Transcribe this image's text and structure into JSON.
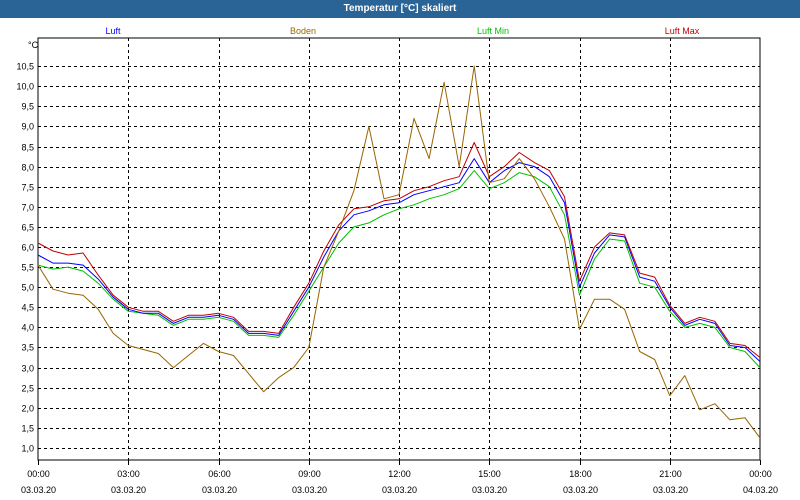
{
  "chart_data": {
    "type": "line",
    "title": "Temperatur [°C] skaliert",
    "ylabel": "°C",
    "ylim": [
      0.7,
      11.2
    ],
    "xlim_hours": [
      0,
      24
    ],
    "grid": true,
    "y_ticks": [
      "1,0",
      "1,5",
      "2,0",
      "2,5",
      "3,0",
      "3,5",
      "4,0",
      "4,5",
      "5,0",
      "5,5",
      "6,0",
      "6,5",
      "7,0",
      "7,5",
      "8,0",
      "8,5",
      "9,0",
      "9,5",
      "10,0",
      "10,5"
    ],
    "x_ticks": [
      {
        "time": "00:00",
        "date": "03.03.20"
      },
      {
        "time": "03:00",
        "date": "03.03.20"
      },
      {
        "time": "06:00",
        "date": "03.03.20"
      },
      {
        "time": "09:00",
        "date": "03.03.20"
      },
      {
        "time": "12:00",
        "date": "03.03.20"
      },
      {
        "time": "15:00",
        "date": "03.03.20"
      },
      {
        "time": "18:00",
        "date": "03.03.20"
      },
      {
        "time": "21:00",
        "date": "03.03.20"
      },
      {
        "time": "00:00",
        "date": "04.03.20"
      }
    ],
    "series": [
      {
        "name": "Luft Min",
        "color": "#00c000",
        "points": [
          [
            0,
            5.55
          ],
          [
            0.5,
            5.45
          ],
          [
            1,
            5.5
          ],
          [
            1.5,
            5.4
          ],
          [
            2,
            5.1
          ],
          [
            2.5,
            4.7
          ],
          [
            3,
            4.4
          ],
          [
            3.5,
            4.35
          ],
          [
            4,
            4.3
          ],
          [
            4.5,
            4.05
          ],
          [
            5,
            4.2
          ],
          [
            5.5,
            4.2
          ],
          [
            6,
            4.25
          ],
          [
            6.5,
            4.15
          ],
          [
            7,
            3.8
          ],
          [
            7.5,
            3.8
          ],
          [
            8,
            3.75
          ],
          [
            8.5,
            4.3
          ],
          [
            9,
            4.9
          ],
          [
            9.5,
            5.5
          ],
          [
            10,
            6.1
          ],
          [
            10.5,
            6.5
          ],
          [
            11,
            6.6
          ],
          [
            11.5,
            6.8
          ],
          [
            12,
            6.95
          ],
          [
            12.5,
            7.05
          ],
          [
            13,
            7.2
          ],
          [
            13.5,
            7.3
          ],
          [
            14,
            7.45
          ],
          [
            14.5,
            7.9
          ],
          [
            15,
            7.45
          ],
          [
            15.5,
            7.6
          ],
          [
            16,
            7.85
          ],
          [
            16.5,
            7.75
          ],
          [
            17,
            7.5
          ],
          [
            17.5,
            6.8
          ],
          [
            18,
            4.8
          ],
          [
            18.5,
            5.7
          ],
          [
            19,
            6.2
          ],
          [
            19.5,
            6.15
          ],
          [
            20,
            5.1
          ],
          [
            20.5,
            5.0
          ],
          [
            21,
            4.4
          ],
          [
            21.5,
            4.0
          ],
          [
            22,
            4.1
          ],
          [
            22.5,
            4.0
          ],
          [
            23,
            3.5
          ],
          [
            23.5,
            3.4
          ],
          [
            24,
            3.0
          ]
        ]
      },
      {
        "name": "Luft",
        "color": "#0000ff",
        "points": [
          [
            0,
            5.8
          ],
          [
            0.5,
            5.6
          ],
          [
            1,
            5.6
          ],
          [
            1.5,
            5.55
          ],
          [
            2,
            5.2
          ],
          [
            2.5,
            4.75
          ],
          [
            3,
            4.45
          ],
          [
            3.5,
            4.35
          ],
          [
            4,
            4.35
          ],
          [
            4.5,
            4.1
          ],
          [
            5,
            4.25
          ],
          [
            5.5,
            4.25
          ],
          [
            6,
            4.3
          ],
          [
            6.5,
            4.2
          ],
          [
            7,
            3.85
          ],
          [
            7.5,
            3.85
          ],
          [
            8,
            3.8
          ],
          [
            8.5,
            4.4
          ],
          [
            9,
            5.0
          ],
          [
            9.5,
            5.75
          ],
          [
            10,
            6.4
          ],
          [
            10.5,
            6.8
          ],
          [
            11,
            6.9
          ],
          [
            11.5,
            7.05
          ],
          [
            12,
            7.1
          ],
          [
            12.5,
            7.3
          ],
          [
            13,
            7.4
          ],
          [
            13.5,
            7.5
          ],
          [
            14,
            7.6
          ],
          [
            14.5,
            8.2
          ],
          [
            15,
            7.6
          ],
          [
            15.5,
            7.9
          ],
          [
            16,
            8.1
          ],
          [
            16.5,
            8.0
          ],
          [
            17,
            7.75
          ],
          [
            17.5,
            7.1
          ],
          [
            18,
            5.0
          ],
          [
            18.5,
            5.85
          ],
          [
            19,
            6.3
          ],
          [
            19.5,
            6.25
          ],
          [
            20,
            5.25
          ],
          [
            20.5,
            5.15
          ],
          [
            21,
            4.5
          ],
          [
            21.5,
            4.05
          ],
          [
            22,
            4.2
          ],
          [
            22.5,
            4.1
          ],
          [
            23,
            3.55
          ],
          [
            23.5,
            3.5
          ],
          [
            24,
            3.15
          ]
        ]
      },
      {
        "name": "Luft Max",
        "color": "#c00000",
        "points": [
          [
            0,
            6.1
          ],
          [
            0.5,
            5.9
          ],
          [
            1,
            5.8
          ],
          [
            1.5,
            5.85
          ],
          [
            2,
            5.3
          ],
          [
            2.5,
            4.8
          ],
          [
            3,
            4.5
          ],
          [
            3.5,
            4.4
          ],
          [
            4,
            4.4
          ],
          [
            4.5,
            4.15
          ],
          [
            5,
            4.3
          ],
          [
            5.5,
            4.3
          ],
          [
            6,
            4.35
          ],
          [
            6.5,
            4.25
          ],
          [
            7,
            3.9
          ],
          [
            7.5,
            3.9
          ],
          [
            8,
            3.85
          ],
          [
            8.5,
            4.5
          ],
          [
            9,
            5.1
          ],
          [
            9.5,
            5.9
          ],
          [
            10,
            6.55
          ],
          [
            10.5,
            6.95
          ],
          [
            11,
            7.0
          ],
          [
            11.5,
            7.15
          ],
          [
            12,
            7.2
          ],
          [
            12.5,
            7.4
          ],
          [
            13,
            7.5
          ],
          [
            13.5,
            7.65
          ],
          [
            14,
            7.75
          ],
          [
            14.5,
            8.6
          ],
          [
            15,
            7.75
          ],
          [
            15.5,
            8.0
          ],
          [
            16,
            8.35
          ],
          [
            16.5,
            8.1
          ],
          [
            17,
            7.9
          ],
          [
            17.5,
            7.25
          ],
          [
            18,
            5.15
          ],
          [
            18.5,
            6.0
          ],
          [
            19,
            6.35
          ],
          [
            19.5,
            6.3
          ],
          [
            20,
            5.35
          ],
          [
            20.5,
            5.25
          ],
          [
            21,
            4.55
          ],
          [
            21.5,
            4.1
          ],
          [
            22,
            4.25
          ],
          [
            22.5,
            4.15
          ],
          [
            23,
            3.6
          ],
          [
            23.5,
            3.55
          ],
          [
            24,
            3.25
          ]
        ]
      },
      {
        "name": "Boden",
        "color": "#996600",
        "points": [
          [
            0,
            5.55
          ],
          [
            0.5,
            4.95
          ],
          [
            1,
            4.85
          ],
          [
            1.5,
            4.8
          ],
          [
            2,
            4.45
          ],
          [
            2.5,
            3.85
          ],
          [
            3,
            3.55
          ],
          [
            3.5,
            3.45
          ],
          [
            4,
            3.35
          ],
          [
            4.5,
            3.0
          ],
          [
            5,
            3.3
          ],
          [
            5.5,
            3.6
          ],
          [
            6,
            3.4
          ],
          [
            6.5,
            3.3
          ],
          [
            7,
            2.85
          ],
          [
            7.5,
            2.4
          ],
          [
            8,
            2.75
          ],
          [
            8.5,
            3.0
          ],
          [
            9,
            3.5
          ],
          [
            9.5,
            5.5
          ],
          [
            10,
            6.4
          ],
          [
            10.5,
            7.4
          ],
          [
            11,
            9.0
          ],
          [
            11.5,
            7.2
          ],
          [
            12,
            7.3
          ],
          [
            12.5,
            9.2
          ],
          [
            13,
            8.2
          ],
          [
            13.5,
            10.1
          ],
          [
            14,
            8.0
          ],
          [
            14.5,
            10.5
          ],
          [
            15,
            7.6
          ],
          [
            15.5,
            7.7
          ],
          [
            16,
            8.2
          ],
          [
            16.5,
            7.7
          ],
          [
            17,
            7.0
          ],
          [
            17.5,
            6.2
          ],
          [
            18,
            3.95
          ],
          [
            18.5,
            4.7
          ],
          [
            19,
            4.7
          ],
          [
            19.5,
            4.45
          ],
          [
            20,
            3.4
          ],
          [
            20.5,
            3.2
          ],
          [
            21,
            2.3
          ],
          [
            21.5,
            2.8
          ],
          [
            22,
            1.95
          ],
          [
            22.5,
            2.1
          ],
          [
            23,
            1.7
          ],
          [
            23.5,
            1.75
          ],
          [
            24,
            1.25
          ]
        ]
      }
    ]
  }
}
